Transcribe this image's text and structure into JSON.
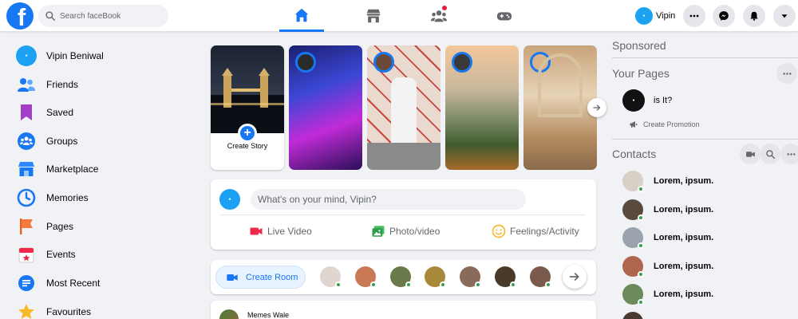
{
  "topbar": {
    "search_placeholder": "Search faceBook",
    "profile_name": "Vipin",
    "nav_tabs": [
      {
        "name": "home",
        "active": true
      },
      {
        "name": "marketplace",
        "active": false
      },
      {
        "name": "groups",
        "active": false,
        "notification": true
      },
      {
        "name": "gaming",
        "active": false
      }
    ],
    "actions": [
      "menu",
      "messenger",
      "notifications",
      "account"
    ]
  },
  "sidebar": {
    "items": [
      {
        "label": "Vipin Beniwal",
        "icon": "profile-avatar"
      },
      {
        "label": "Friends",
        "icon": "friends-icon"
      },
      {
        "label": "Saved",
        "icon": "bookmark-icon"
      },
      {
        "label": "Groups",
        "icon": "groups-icon"
      },
      {
        "label": "Marketplace",
        "icon": "store-icon"
      },
      {
        "label": "Memories",
        "icon": "clock-icon"
      },
      {
        "label": "Pages",
        "icon": "flag-icon"
      },
      {
        "label": "Events",
        "icon": "calendar-icon"
      },
      {
        "label": "Most Recent",
        "icon": "recent-icon"
      },
      {
        "label": "Favourites",
        "icon": "star-icon"
      }
    ]
  },
  "stories": {
    "create_label": "Create Story"
  },
  "composer": {
    "prompt": "What's on your mind, Vipin?",
    "actions": [
      {
        "label": "Live Video",
        "icon": "live-video-icon",
        "color": "#f02849"
      },
      {
        "label": "Photo/video",
        "icon": "photo-icon",
        "color": "#45bd62"
      },
      {
        "label": "Feelings/Activity",
        "icon": "smiley-icon",
        "color": "#f7b928"
      }
    ]
  },
  "rooms": {
    "create_label": "Create Room"
  },
  "post": {
    "author": "Memes Wale"
  },
  "right": {
    "sponsored_title": "Sponsored",
    "pages_title": "Your Pages",
    "page_name": "is It?",
    "create_promotion": "Create Promotion",
    "contacts_title": "Contacts",
    "contacts": [
      {
        "name": "Lorem, ipsum."
      },
      {
        "name": "Lorem, ipsum."
      },
      {
        "name": "Lorem, ipsum."
      },
      {
        "name": "Lorem, ipsum."
      },
      {
        "name": "Lorem, ipsum."
      }
    ]
  },
  "colors": {
    "brand": "#1877f2",
    "online": "#31a24c",
    "page_bg": "#f0f2f5"
  }
}
